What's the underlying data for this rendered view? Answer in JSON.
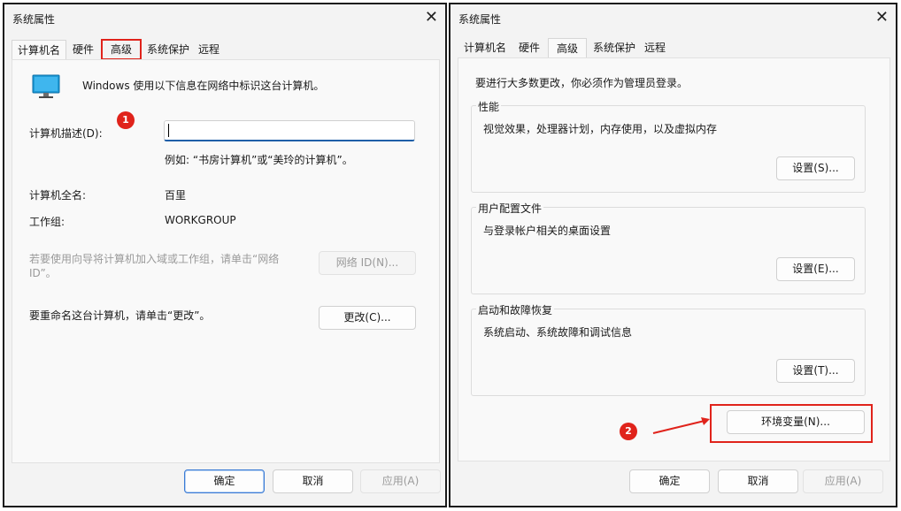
{
  "left_dialog": {
    "title": "系统属性",
    "close": "✕",
    "tabs": [
      "计算机名",
      "硬件",
      "高级",
      "系统保护",
      "远程"
    ],
    "intro": "Windows 使用以下信息在网络中标识这台计算机。",
    "description_label": "计算机描述(D):",
    "description_value": "",
    "example": "例如: “书房计算机”或“美玲的计算机”。",
    "fullname_label": "计算机全名:",
    "fullname_value": "百里",
    "workgroup_label": "工作组:",
    "workgroup_value": "WORKGROUP",
    "wizard_text_line1": "若要使用向导将计算机加入域或工作组，请单击“网络",
    "wizard_text_line2": "ID”。",
    "network_id_button": "网络 ID(N)...",
    "rename_text": "要重命名这台计算机，请单击“更改”。",
    "change_button": "更改(C)...",
    "ok_button": "确定",
    "cancel_button": "取消",
    "apply_button": "应用(A)",
    "badge": "1",
    "icon": "monitor-icon"
  },
  "right_dialog": {
    "title": "系统属性",
    "close": "✕",
    "tabs": [
      "计算机名",
      "硬件",
      "高级",
      "系统保护",
      "远程"
    ],
    "admin_notice": "要进行大多数更改，你必须作为管理员登录。",
    "performance": {
      "legend": "性能",
      "desc": "视觉效果，处理器计划，内存使用，以及虚拟内存",
      "button": "设置(S)..."
    },
    "user_profiles": {
      "legend": "用户配置文件",
      "desc": "与登录帐户相关的桌面设置",
      "button": "设置(E)..."
    },
    "startup_recovery": {
      "legend": "启动和故障恢复",
      "desc": "系统启动、系统故障和调试信息",
      "button": "设置(T)..."
    },
    "env_button": "环境变量(N)...",
    "ok_button": "确定",
    "cancel_button": "取消",
    "apply_button": "应用(A)",
    "badge": "2"
  },
  "colors": {
    "annotation_red": "#e0231b",
    "focus_blue": "#3a7bd5"
  }
}
